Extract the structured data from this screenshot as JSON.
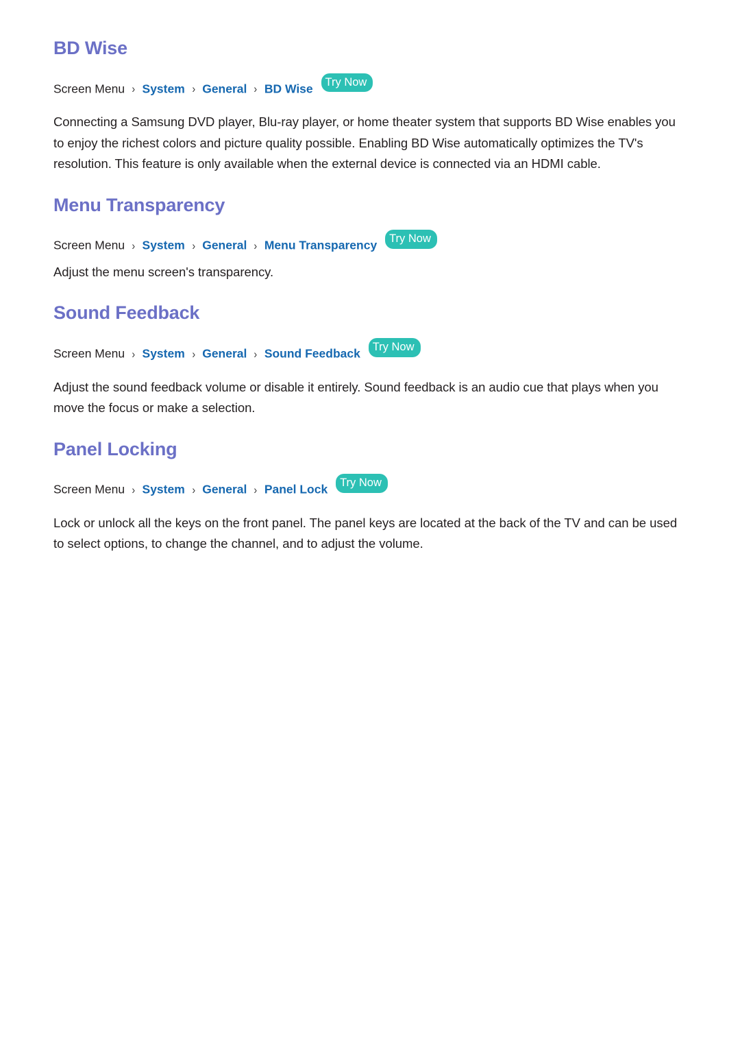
{
  "document": {
    "background_color": "#ffffff",
    "heading_color": "#6b70c6",
    "link_color": "#1668b0",
    "body_color": "#231f20",
    "badge_color": "#2cc0b4",
    "badge_text_color": "#ffffff"
  },
  "common": {
    "breadcrumb_root": "Screen Menu",
    "breadcrumb_system": "System",
    "breadcrumb_general": "General",
    "separator": "›",
    "try_now_label": "Try Now"
  },
  "sections": [
    {
      "id": "bd-wise",
      "title": "BD Wise",
      "breadcrumb_leaf": "BD Wise",
      "body": "Connecting a Samsung DVD player, Blu-ray player, or home theater system that supports BD Wise enables you to enjoy the richest colors and picture quality possible. Enabling BD Wise automatically optimizes the TV's resolution. This feature is only available when the external device is connected via an HDMI cable."
    },
    {
      "id": "menu-transparency",
      "title": "Menu Transparency",
      "breadcrumb_leaf": "Menu Transparency",
      "body": "Adjust the menu screen's transparency."
    },
    {
      "id": "sound-feedback",
      "title": "Sound Feedback",
      "breadcrumb_leaf": "Sound Feedback",
      "body": "Adjust the sound feedback volume or disable it entirely. Sound feedback is an audio cue that plays when you move the focus or make a selection."
    },
    {
      "id": "panel-locking",
      "title": "Panel Locking",
      "breadcrumb_leaf": "Panel Lock",
      "body": "Lock or unlock all the keys on the front panel. The panel keys are located at the back of the TV and can be used to select options, to change the channel, and to adjust the volume."
    }
  ]
}
